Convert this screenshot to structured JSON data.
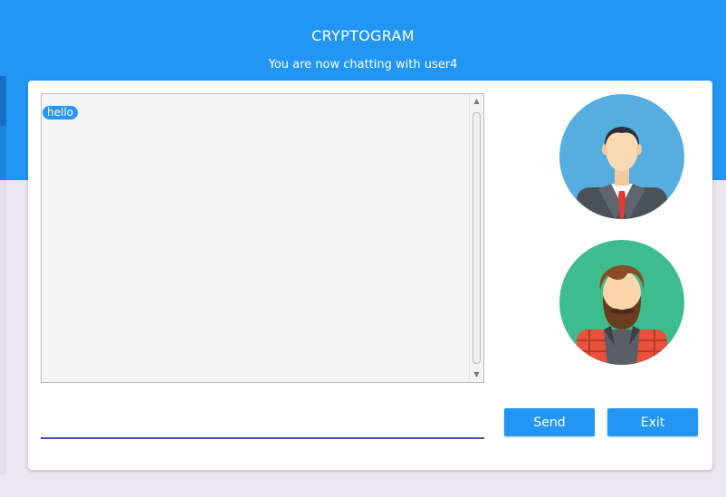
{
  "app": {
    "title": "CRYPTOGRAM",
    "subtitle": "You are now chatting with user4"
  },
  "chat": {
    "messages": [
      {
        "text": "hello"
      }
    ],
    "input": {
      "value": "",
      "placeholder": ""
    }
  },
  "buttons": {
    "send": "Send",
    "exit": "Exit"
  },
  "avatars": {
    "self": "businessman-avatar-icon",
    "peer": "bearded-man-avatar-icon"
  },
  "colors": {
    "header": "#2196f3",
    "accent": "#2196f3",
    "input_underline": "#3f51b5",
    "background": "#ece6f1"
  }
}
